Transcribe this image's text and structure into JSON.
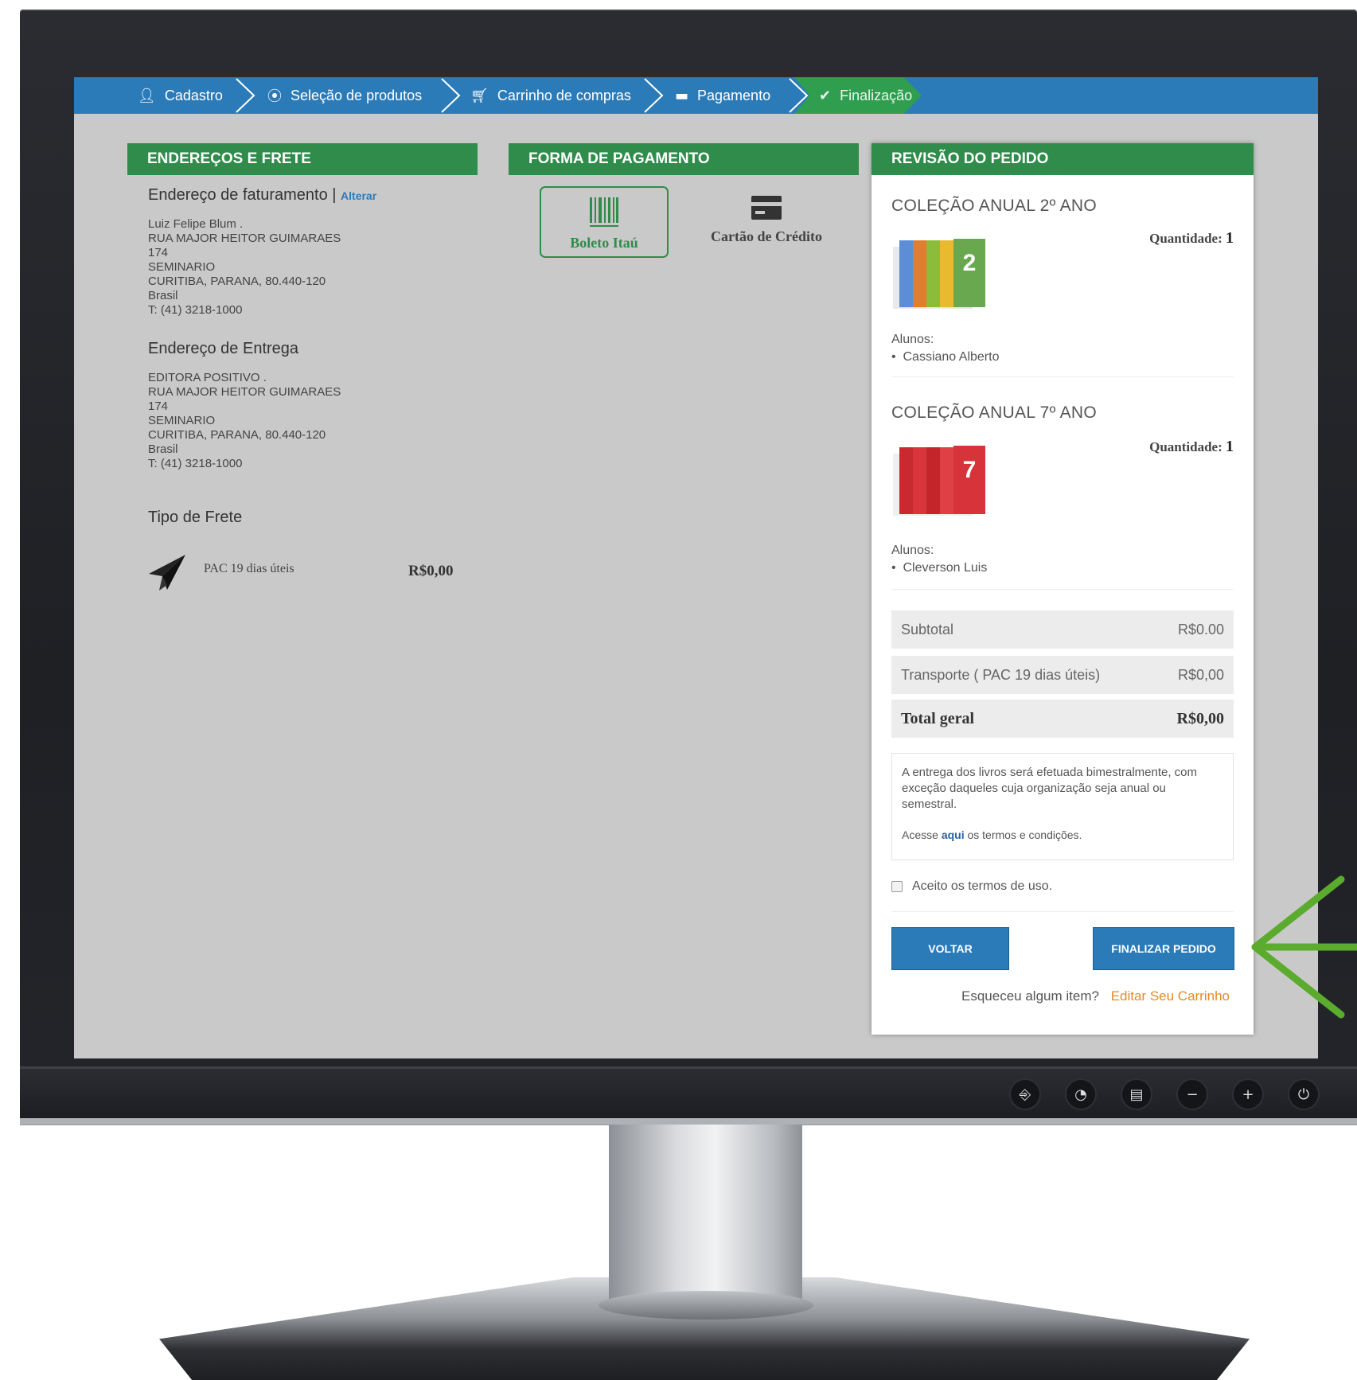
{
  "steps": [
    {
      "label": "Cadastro",
      "icon": "user-icon"
    },
    {
      "label": "Seleção de produtos",
      "icon": "circle-icon"
    },
    {
      "label": "Carrinho de compras",
      "icon": "cart-icon"
    },
    {
      "label": "Pagamento",
      "icon": "card-icon"
    },
    {
      "label": "Finalização",
      "icon": "check-circle-icon",
      "active": true
    }
  ],
  "addresses": {
    "header": "ENDEREÇOS E FRETE",
    "billing_title": "Endereço de faturamento |",
    "billing_edit": "Alterar",
    "billing_lines": [
      "Luiz Felipe Blum .",
      "RUA MAJOR HEITOR GUIMARAES",
      "174",
      "SEMINARIO",
      "CURITIBA, PARANA, 80.440-120",
      "Brasil",
      "T: (41) 3218-1000"
    ],
    "shipping_title": "Endereço de Entrega",
    "shipping_lines": [
      "EDITORA POSITIVO .",
      "RUA MAJOR HEITOR GUIMARAES",
      "174",
      "SEMINARIO",
      "CURITIBA, PARANA, 80.440-120",
      "Brasil",
      "T: (41) 3218-1000"
    ],
    "freight_title": "Tipo de Frete",
    "freight_label": "PAC 19 dias úteis",
    "freight_price": "R$0,00"
  },
  "payment": {
    "header": "FORMA DE PAGAMENTO",
    "option_boleto": "Boleto Itaú",
    "option_card": "Cartão de Crédito"
  },
  "review": {
    "header": "REVISÃO DO PEDIDO",
    "items": [
      {
        "title": "COLEÇÃO ANUAL 2º ANO",
        "qty_label": "Quantidade:",
        "qty": "1",
        "students_label": "Alunos:",
        "student": "Cassiano Alberto",
        "cover_number": "2",
        "color": "#6aa84f"
      },
      {
        "title": "COLEÇÃO ANUAL 7º ANO",
        "qty_label": "Quantidade:",
        "qty": "1",
        "students_label": "Alunos:",
        "student": "Cleverson Luis",
        "cover_number": "7",
        "color": "#d6343a"
      }
    ],
    "subtotal_label": "Subtotal",
    "subtotal_value": "R$0.00",
    "transport_label": "Transporte ( PAC 19 dias úteis)",
    "transport_value": "R$0,00",
    "total_label": "Total geral",
    "total_value": "R$0,00",
    "delivery_note": "A entrega dos livros será efetuada bimestralmente, com exceção daqueles cuja organização seja anual ou semestral.",
    "terms_prefix": "Acesse",
    "terms_link": "aqui",
    "terms_suffix": "os termos e condições.",
    "accept_label": "Aceito os termos de uso.",
    "back_button": "VOLTAR",
    "finish_button": "FINALIZAR PEDIDO",
    "forgot_text": "Esqueceu algum item?",
    "edit_cart": "Editar Seu Carrinho"
  },
  "monitor_controls": [
    "input-icon",
    "menu-icon",
    "auto-icon",
    "minus-icon",
    "plus-icon",
    "power-icon"
  ]
}
